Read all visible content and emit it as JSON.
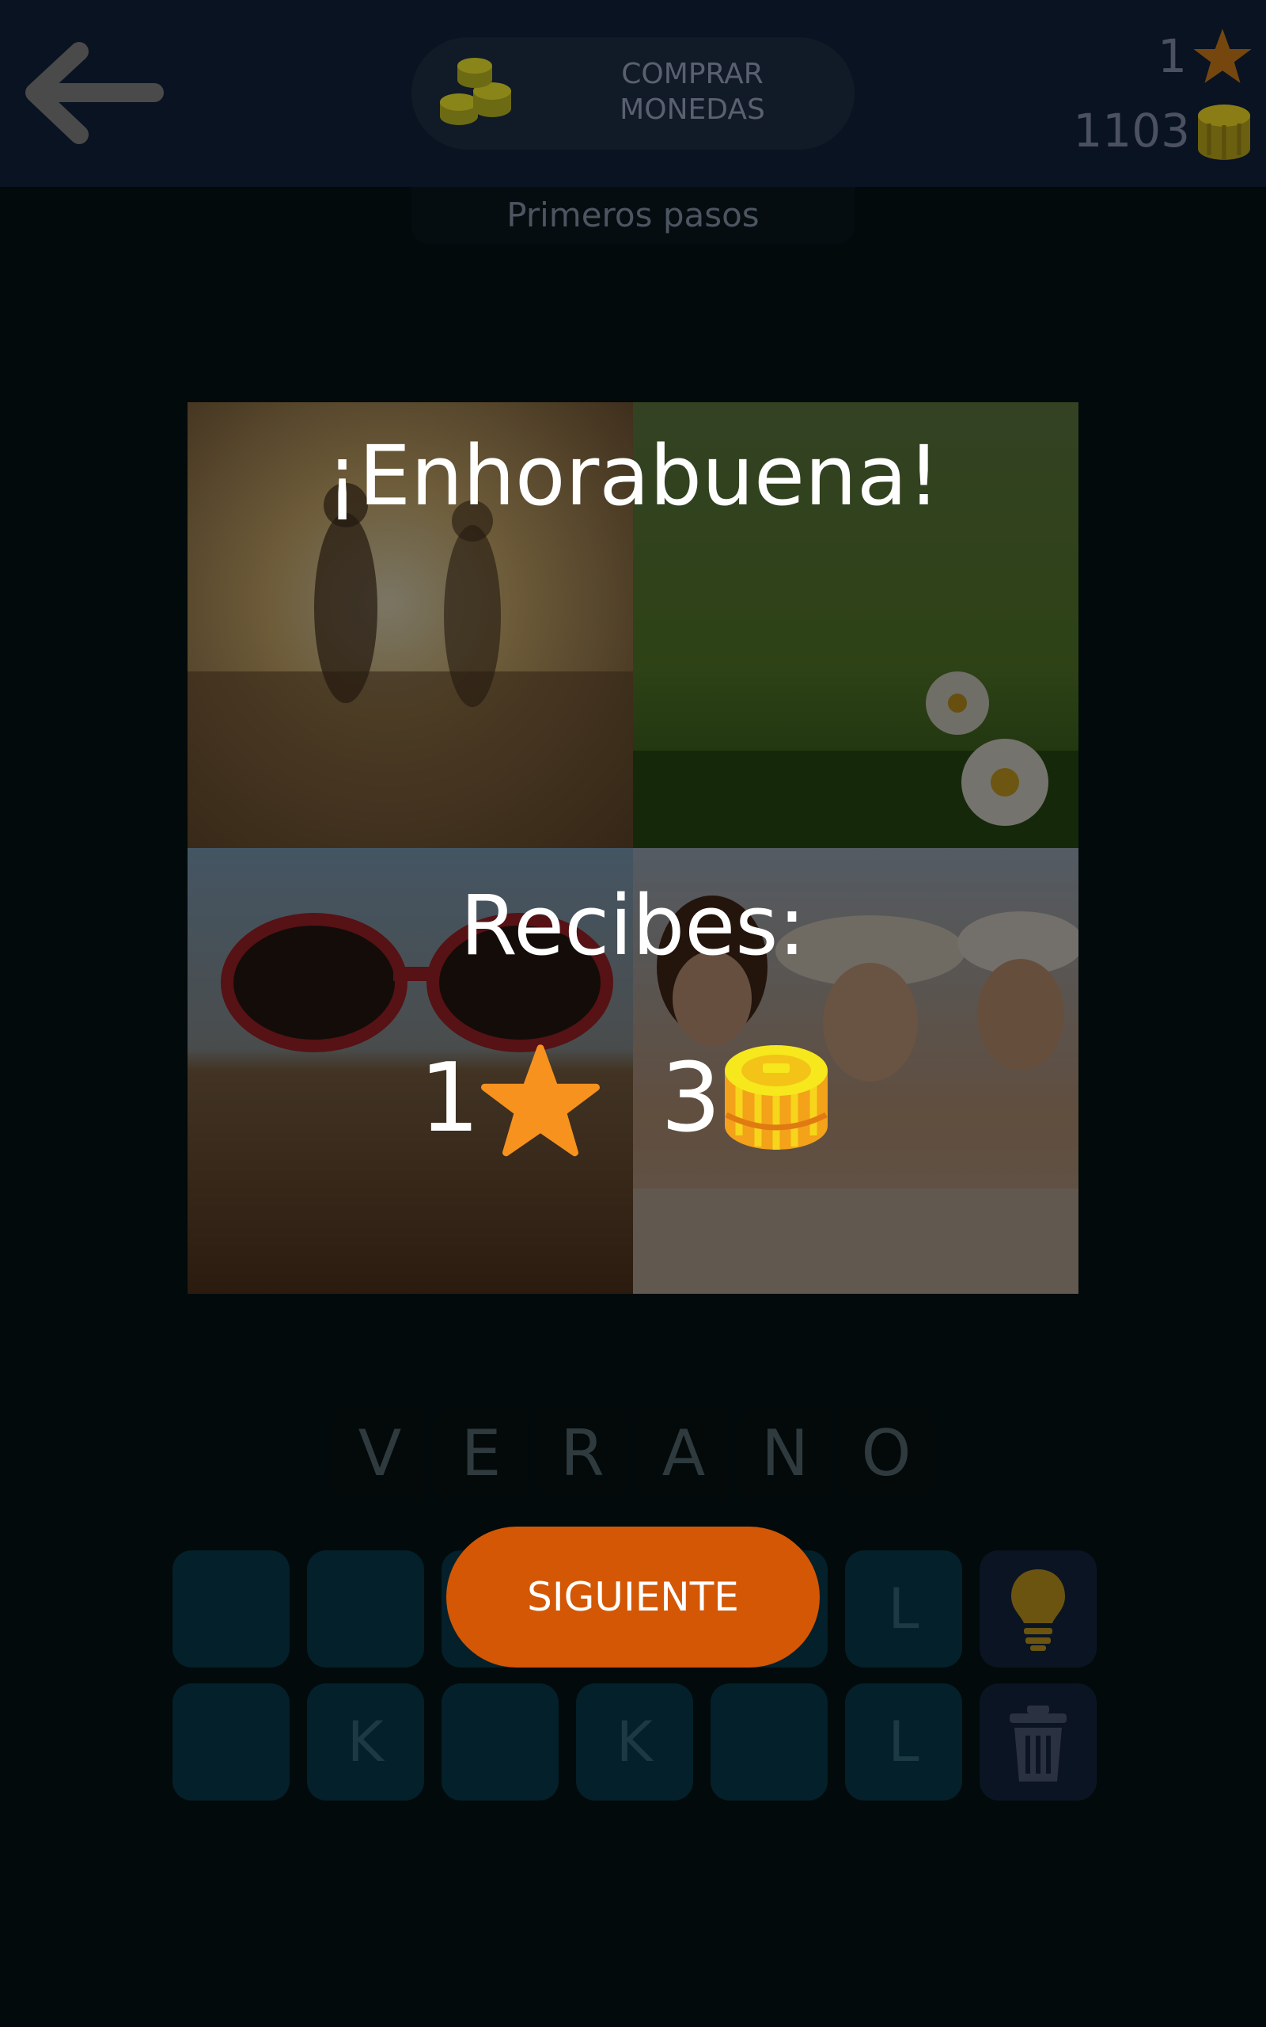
{
  "header": {
    "back_icon": "arrow-left-icon",
    "buy_button": {
      "line1": "COMPRAR",
      "line2": "MONEDAS",
      "icon": "coins-icon"
    },
    "stars": "1",
    "coins": "1103",
    "subtitle": "Primeros pasos"
  },
  "dialog": {
    "title": "¡Enhorabuena!",
    "receive_label": "Recibes:",
    "reward_stars": "1",
    "reward_coins": "3",
    "next_button": "SIGUIENTE"
  },
  "answer": {
    "letters": [
      "V",
      "E",
      "R",
      "A",
      "N",
      "O"
    ]
  },
  "keyboard": {
    "row1": [
      "",
      "",
      "",
      "",
      "",
      "L"
    ],
    "row2": [
      "",
      "K",
      "",
      "K",
      "",
      "L"
    ]
  },
  "colors": {
    "accent_orange": "#d35704",
    "star": "#f7921e",
    "coin": "#f2d01b"
  }
}
